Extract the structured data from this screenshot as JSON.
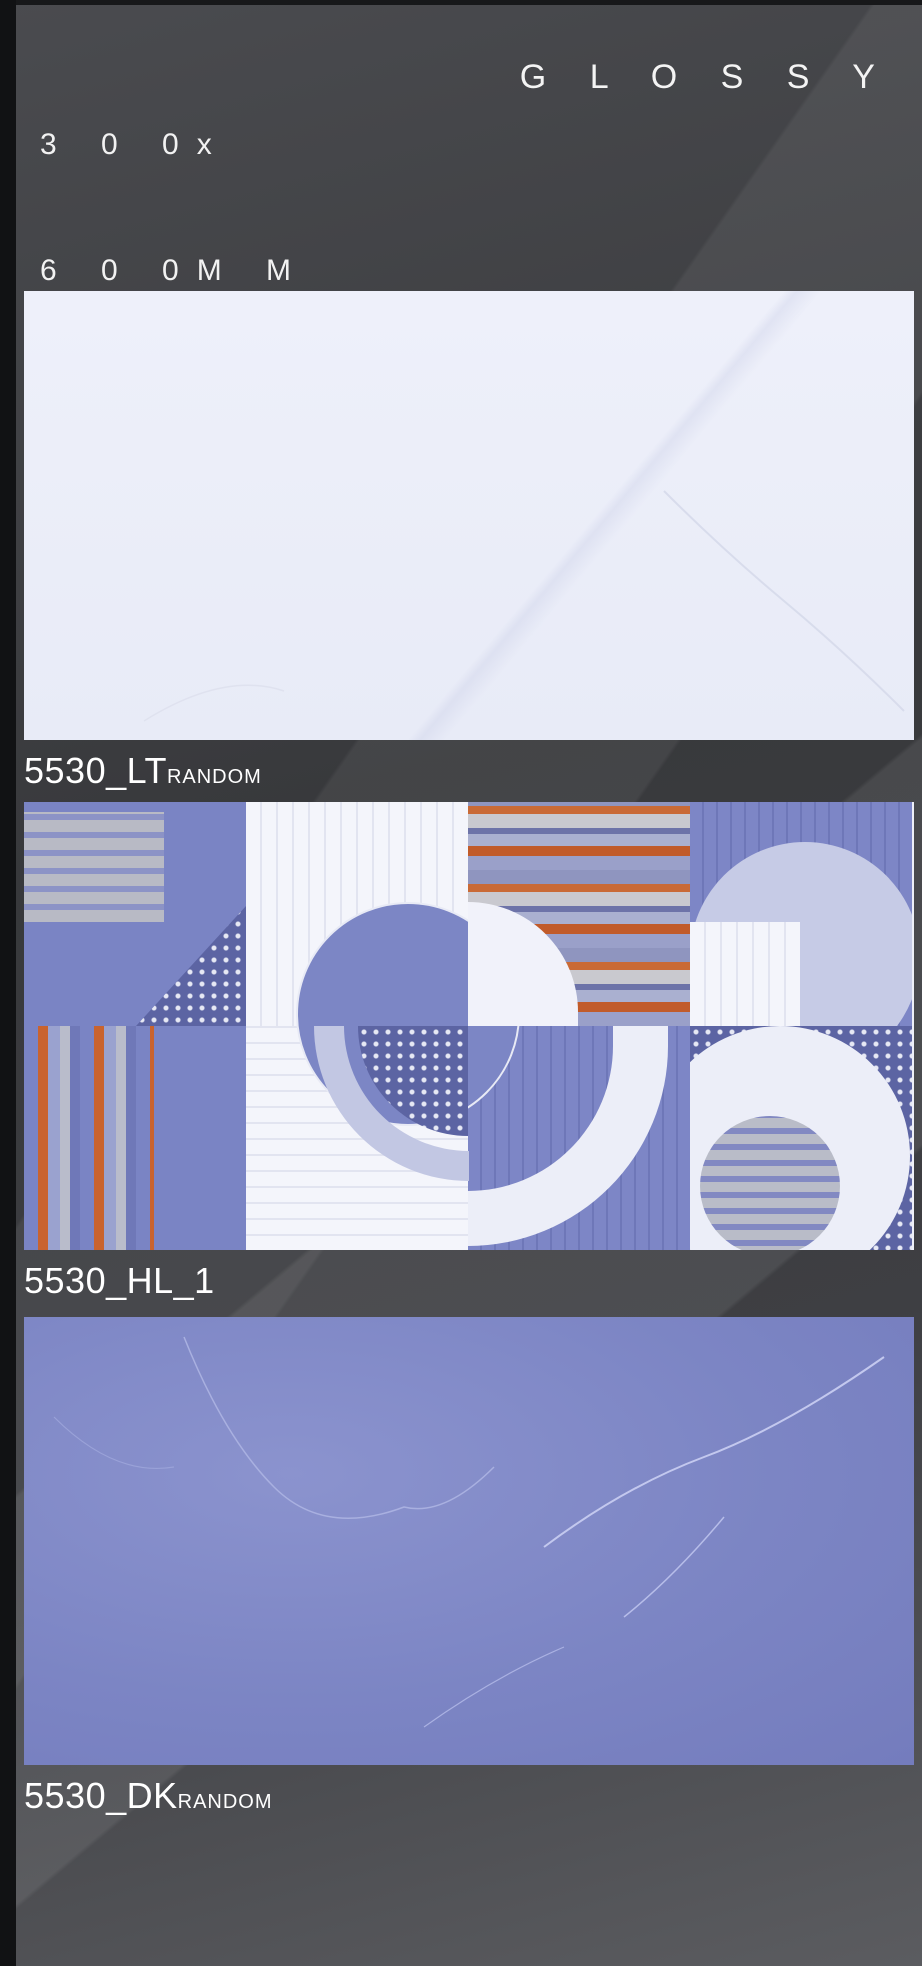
{
  "header": {
    "size_line1": "3 0 0x",
    "size_line2": "6 0 0M M",
    "finish": "G L O S S Y"
  },
  "tiles": [
    {
      "code": "5530_LT",
      "suffix": "RANDOM"
    },
    {
      "code": "5530_HL_1",
      "suffix": ""
    },
    {
      "code": "5530_DK",
      "suffix": "RANDOM"
    }
  ]
}
